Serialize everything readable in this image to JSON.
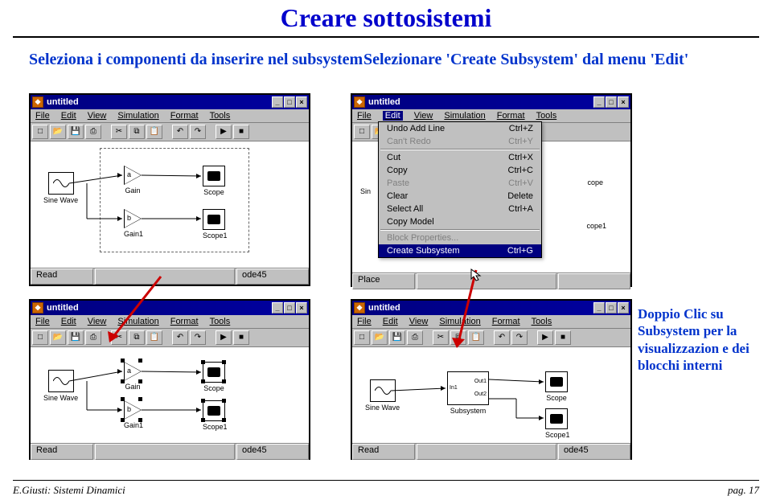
{
  "title": "Creare sottosistemi",
  "caption_left": "Seleziona i componenti da inserire nel subsystem",
  "caption_right": "Selezionare 'Create Subsystem' dal menu 'Edit'",
  "caption_callout": "Doppio Clic su Subsystem per la visualizzazion e dei blocchi interni",
  "window_title": "untitled",
  "menu": [
    "File",
    "Edit",
    "View",
    "Simulation",
    "Format",
    "Tools"
  ],
  "blocks": {
    "sine": "Sine Wave",
    "gain": "Gain",
    "gain1": "Gain1",
    "scope": "Scope",
    "scope1": "Scope1",
    "subsystem": "Subsystem",
    "sub_ports": [
      "Out1",
      "In1",
      "Out2"
    ],
    "gain_a": "a",
    "gain_b": "b"
  },
  "status": {
    "read": "Read",
    "ode": "ode45",
    "place": "Place"
  },
  "edit_menu": [
    {
      "label": "Undo Add Line",
      "accel": "Ctrl+Z",
      "disabled": false
    },
    {
      "label": "Can't Redo",
      "accel": "Ctrl+Y",
      "disabled": true
    },
    {
      "sep": true
    },
    {
      "label": "Cut",
      "accel": "Ctrl+X",
      "disabled": false
    },
    {
      "label": "Copy",
      "accel": "Ctrl+C",
      "disabled": false
    },
    {
      "label": "Paste",
      "accel": "Ctrl+V",
      "disabled": true
    },
    {
      "label": "Clear",
      "accel": "Delete",
      "disabled": false
    },
    {
      "label": "Select All",
      "accel": "Ctrl+A",
      "disabled": false
    },
    {
      "label": "Copy Model",
      "accel": "",
      "disabled": false
    },
    {
      "sep": true
    },
    {
      "label": "Block Properties...",
      "accel": "",
      "disabled": true
    },
    {
      "label": "Create Subsystem",
      "accel": "Ctrl+G",
      "hilite": true
    }
  ],
  "footer_left": "E.Giusti: Sistemi Dinamici",
  "footer_right": "pag. 17"
}
